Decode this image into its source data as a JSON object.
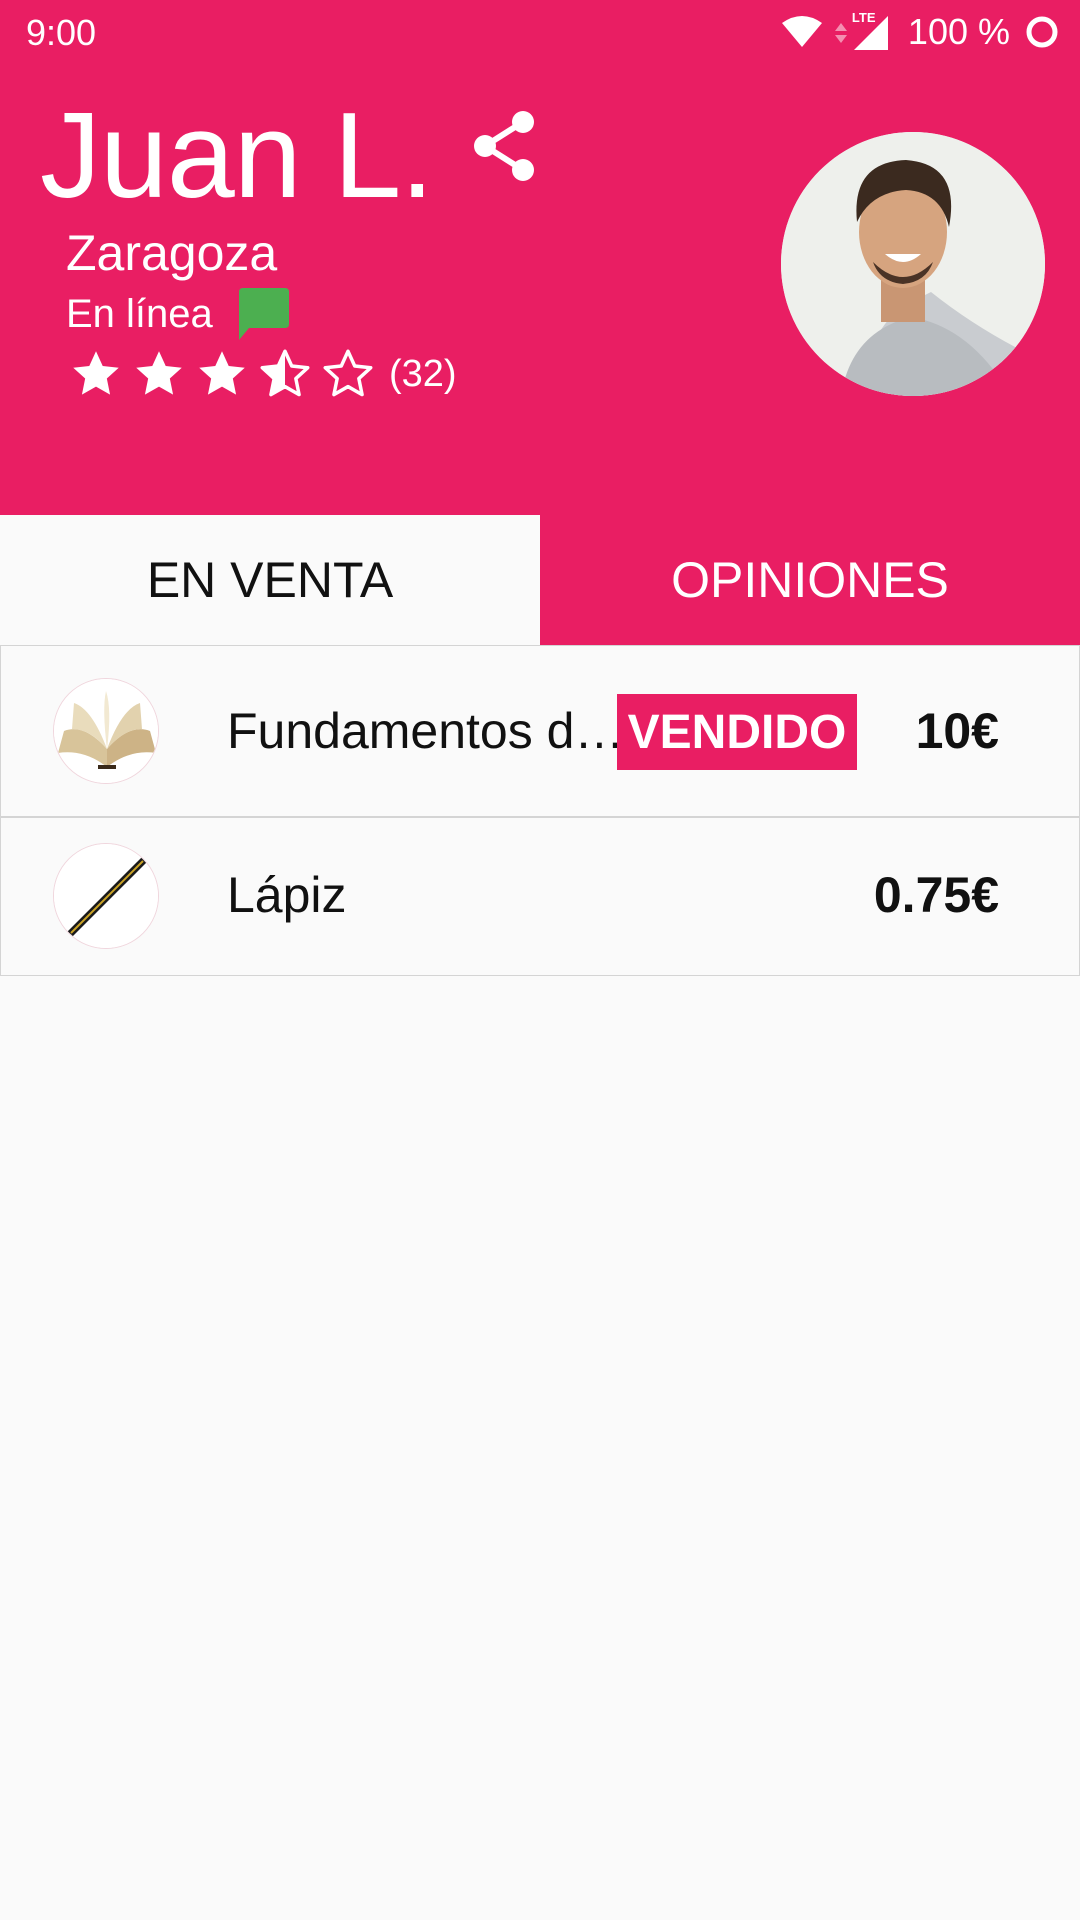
{
  "status_bar": {
    "time": "9:00",
    "network": "LTE",
    "battery": "100 %",
    "icons": [
      "wifi-icon",
      "lte-data-icon",
      "signal-icon",
      "battery-icon"
    ]
  },
  "profile": {
    "name": "Juan L.",
    "city": "Zaragoza",
    "status": "En línea",
    "rating": 3.5,
    "rating_max": 5,
    "review_count": "(32)",
    "icons": {
      "share": "share-icon",
      "chat": "chat-icon"
    }
  },
  "tabs": [
    {
      "label": "EN VENTA",
      "active": true
    },
    {
      "label": "OPINIONES",
      "active": false
    }
  ],
  "items": [
    {
      "title": "Fundamentos d…",
      "badge": "VENDIDO",
      "price": "10€",
      "thumb": "book-icon"
    },
    {
      "title": "Lápiz",
      "badge": "",
      "price": "0.75€",
      "thumb": "pencil-icon"
    }
  ],
  "colors": {
    "primary": "#e91e63",
    "online": "#4caf50",
    "background": "#fafafa",
    "text": "#111111"
  }
}
